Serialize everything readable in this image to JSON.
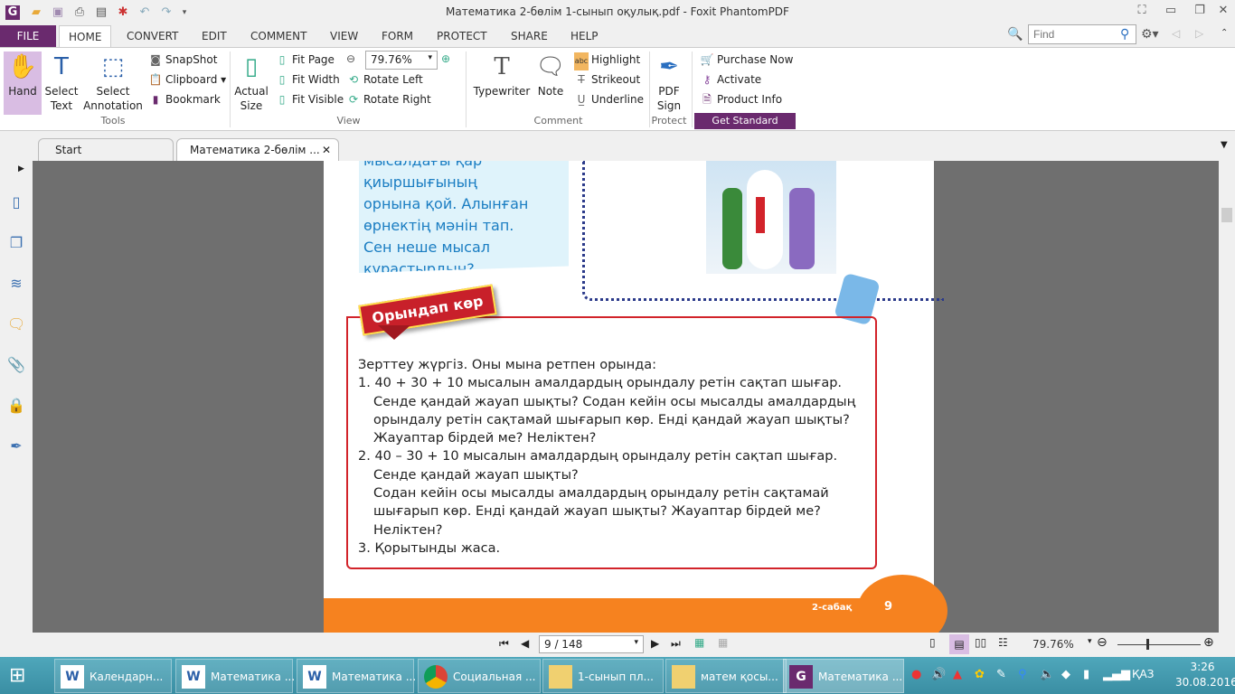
{
  "window": {
    "title": "Математика 2-бөлім 1-сынып оқулық.pdf - Foxit PhantomPDF"
  },
  "menu": {
    "tabs": [
      "FILE",
      "HOME",
      "CONVERT",
      "EDIT",
      "COMMENT",
      "VIEW",
      "FORM",
      "PROTECT",
      "SHARE",
      "HELP"
    ],
    "find_placeholder": "Find"
  },
  "ribbon": {
    "tools": {
      "hand": "Hand",
      "select_text": "Select Text",
      "select_annotation": "Select Annotation",
      "snapshot": "SnapShot",
      "clipboard": "Clipboard",
      "bookmark": "Bookmark",
      "group": "Tools"
    },
    "view": {
      "actual_size": "Actual Size",
      "fit_page": "Fit Page",
      "fit_width": "Fit Width",
      "fit_visible": "Fit Visible",
      "zoom": "79.76%",
      "rotate_left": "Rotate Left",
      "rotate_right": "Rotate Right",
      "group": "View"
    },
    "comment": {
      "typewriter": "Typewriter",
      "note": "Note",
      "highlight": "Highlight",
      "strikeout": "Strikeout",
      "underline": "Underline",
      "group": "Comment"
    },
    "protect": {
      "pdf_sign": "PDF Sign",
      "group": "Protect"
    },
    "standard": {
      "purchase": "Purchase Now",
      "activate": "Activate",
      "product_info": "Product Info",
      "get_standard": "Get Standard"
    }
  },
  "doc_tabs": [
    "Start",
    "Математика 2-бөлім ..."
  ],
  "page": {
    "blue_box": [
      "мысалдағы қар қиыршығының",
      "орнына қой. Алынған",
      "өрнектің мәнін тап.",
      "Сен неше мысал",
      "құрастырдың?"
    ],
    "banner": "Орындап көр",
    "task": [
      "Зерттеу жүргіз. Оны мына ретпен орында:",
      "1. 40 + 30 + 10 мысалын амалдардың орындалу ретін сақтап шығар.",
      "Сенде қандай жауап шықты? Содан кейін осы мысалды амалдардың",
      "орындалу ретін сақтамай шығарып көр. Енді қандай жауап шықты?",
      "Жауаптар бірдей ме? Неліктен?",
      "2. 40 – 30 + 10 мысалын амалдардың орындалу ретін сақтап шығар.",
      "Сенде қандай жауап шықты?",
      "Содан кейін осы мысалды амалдардың орындалу ретін сақтамай",
      "шығарып көр. Енді қандай жауап шықты? Жауаптар бірдей ме? Неліктен?",
      "3. Қорытынды жаса."
    ],
    "footer_lesson": "2-сабақ",
    "page_number": "9"
  },
  "status": {
    "page": "9 / 148",
    "zoom": "79.76%"
  },
  "taskbar": {
    "items": [
      "Календарн...",
      "Математика ...",
      "Математика ...",
      "Социальная ...",
      "1-сынып пл...",
      "матем қосы...",
      "Математика ..."
    ],
    "lang": "ҚАЗ",
    "time": "3:26",
    "date": "30.08.2016"
  }
}
